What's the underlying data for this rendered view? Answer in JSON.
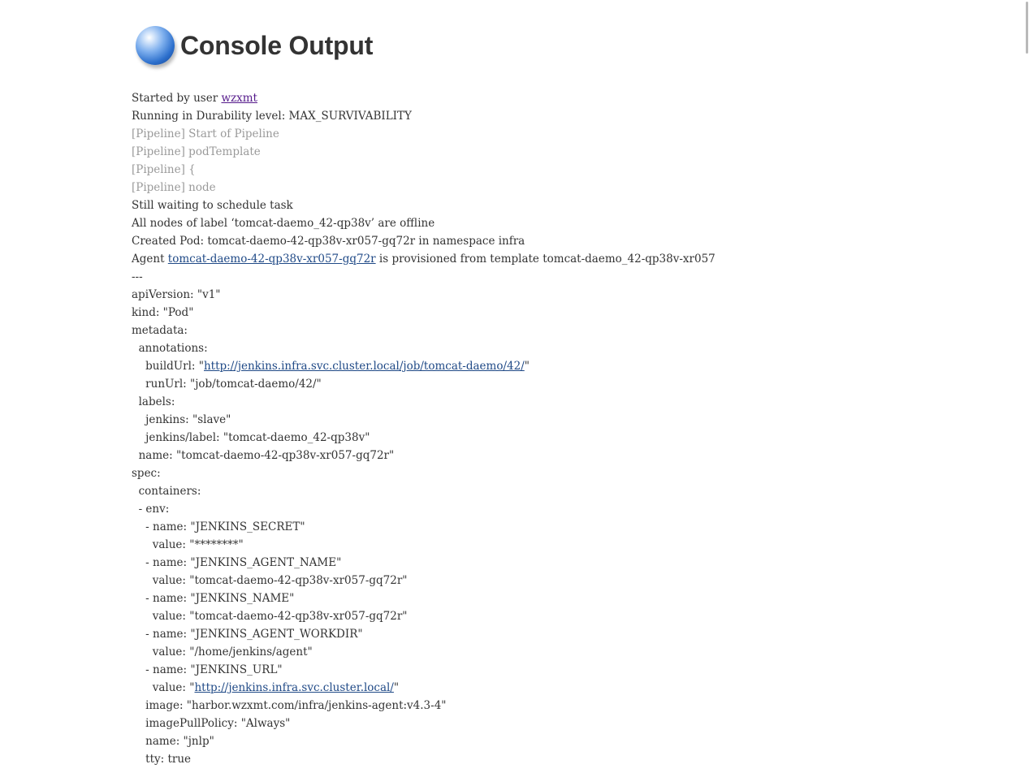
{
  "header": {
    "title": "Console Output",
    "icon": "status-ball-blue-icon"
  },
  "console": [
    {
      "segs": [
        {
          "t": "Started by user "
        },
        {
          "t": "wzxmt",
          "link": "visited",
          "name": "user-link"
        }
      ]
    },
    {
      "segs": [
        {
          "t": "Running in Durability level: MAX_SURVIVABILITY"
        }
      ]
    },
    {
      "dim": true,
      "segs": [
        {
          "t": "[Pipeline] Start of Pipeline"
        }
      ]
    },
    {
      "dim": true,
      "segs": [
        {
          "t": "[Pipeline] podTemplate"
        }
      ]
    },
    {
      "dim": true,
      "segs": [
        {
          "t": "[Pipeline] {"
        }
      ]
    },
    {
      "dim": true,
      "segs": [
        {
          "t": "[Pipeline] node"
        }
      ]
    },
    {
      "segs": [
        {
          "t": "Still waiting to schedule task"
        }
      ]
    },
    {
      "segs": [
        {
          "t": "All nodes of label ‘tomcat-daemo_42-qp38v’ are offline"
        }
      ]
    },
    {
      "segs": [
        {
          "t": "Created Pod: tomcat-daemo-42-qp38v-xr057-gq72r in namespace infra"
        }
      ]
    },
    {
      "segs": [
        {
          "t": "Agent "
        },
        {
          "t": "tomcat-daemo-42-qp38v-xr057-gq72r",
          "link": "normal",
          "name": "agent-link"
        },
        {
          "t": " is provisioned from template tomcat-daemo_42-qp38v-xr057"
        }
      ]
    },
    {
      "segs": [
        {
          "t": "---"
        }
      ]
    },
    {
      "segs": [
        {
          "t": "apiVersion: \"v1\""
        }
      ]
    },
    {
      "segs": [
        {
          "t": "kind: \"Pod\""
        }
      ]
    },
    {
      "segs": [
        {
          "t": "metadata:"
        }
      ]
    },
    {
      "segs": [
        {
          "t": "  annotations:"
        }
      ]
    },
    {
      "segs": [
        {
          "t": "    buildUrl: \""
        },
        {
          "t": "http://jenkins.infra.svc.cluster.local/job/tomcat-daemo/42/",
          "link": "normal",
          "name": "build-url-link"
        },
        {
          "t": "\""
        }
      ]
    },
    {
      "segs": [
        {
          "t": "    runUrl: \"job/tomcat-daemo/42/\""
        }
      ]
    },
    {
      "segs": [
        {
          "t": "  labels:"
        }
      ]
    },
    {
      "segs": [
        {
          "t": "    jenkins: \"slave\""
        }
      ]
    },
    {
      "segs": [
        {
          "t": "    jenkins/label: \"tomcat-daemo_42-qp38v\""
        }
      ]
    },
    {
      "segs": [
        {
          "t": "  name: \"tomcat-daemo-42-qp38v-xr057-gq72r\""
        }
      ]
    },
    {
      "segs": [
        {
          "t": "spec:"
        }
      ]
    },
    {
      "segs": [
        {
          "t": "  containers:"
        }
      ]
    },
    {
      "segs": [
        {
          "t": "  - env:"
        }
      ]
    },
    {
      "segs": [
        {
          "t": "    - name: \"JENKINS_SECRET\""
        }
      ]
    },
    {
      "segs": [
        {
          "t": "      value: \"********\""
        }
      ]
    },
    {
      "segs": [
        {
          "t": "    - name: \"JENKINS_AGENT_NAME\""
        }
      ]
    },
    {
      "segs": [
        {
          "t": "      value: \"tomcat-daemo-42-qp38v-xr057-gq72r\""
        }
      ]
    },
    {
      "segs": [
        {
          "t": "    - name: \"JENKINS_NAME\""
        }
      ]
    },
    {
      "segs": [
        {
          "t": "      value: \"tomcat-daemo-42-qp38v-xr057-gq72r\""
        }
      ]
    },
    {
      "segs": [
        {
          "t": "    - name: \"JENKINS_AGENT_WORKDIR\""
        }
      ]
    },
    {
      "segs": [
        {
          "t": "      value: \"/home/jenkins/agent\""
        }
      ]
    },
    {
      "segs": [
        {
          "t": "    - name: \"JENKINS_URL\""
        }
      ]
    },
    {
      "segs": [
        {
          "t": "      value: \""
        },
        {
          "t": "http://jenkins.infra.svc.cluster.local/",
          "link": "normal",
          "name": "jenkins-url-link"
        },
        {
          "t": "\""
        }
      ]
    },
    {
      "segs": [
        {
          "t": "    image: \"harbor.wzxmt.com/infra/jenkins-agent:v4.3-4\""
        }
      ]
    },
    {
      "segs": [
        {
          "t": "    imagePullPolicy: \"Always\""
        }
      ]
    },
    {
      "segs": [
        {
          "t": "    name: \"jnlp\""
        }
      ]
    },
    {
      "segs": [
        {
          "t": "    tty: true"
        }
      ]
    }
  ]
}
